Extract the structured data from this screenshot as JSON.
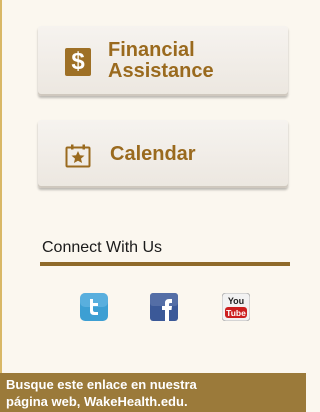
{
  "sidebar": {
    "financial": {
      "line1": "Financial",
      "line2": "Assistance",
      "icon": "dollar-icon",
      "icon_glyph": "$"
    },
    "calendar": {
      "label": "Calendar",
      "icon": "calendar-star-icon"
    }
  },
  "connect": {
    "title": "Connect With Us",
    "social": {
      "twitter_icon": "twitter-icon",
      "facebook_icon": "facebook-icon",
      "youtube_icon": "youtube-icon",
      "youtube_top": "You",
      "youtube_bottom": "Tube"
    }
  },
  "banner": {
    "line1": "Busque este enlace en nuestra",
    "line2": "página web, WakeHealth.edu."
  },
  "colors": {
    "accent": "#9a6a1e",
    "rule": "#8f6a2a",
    "banner": "#9b7a3a",
    "twitter": "#3d9fd3",
    "facebook": "#3b5998",
    "youtube": "#cc1f1f"
  }
}
